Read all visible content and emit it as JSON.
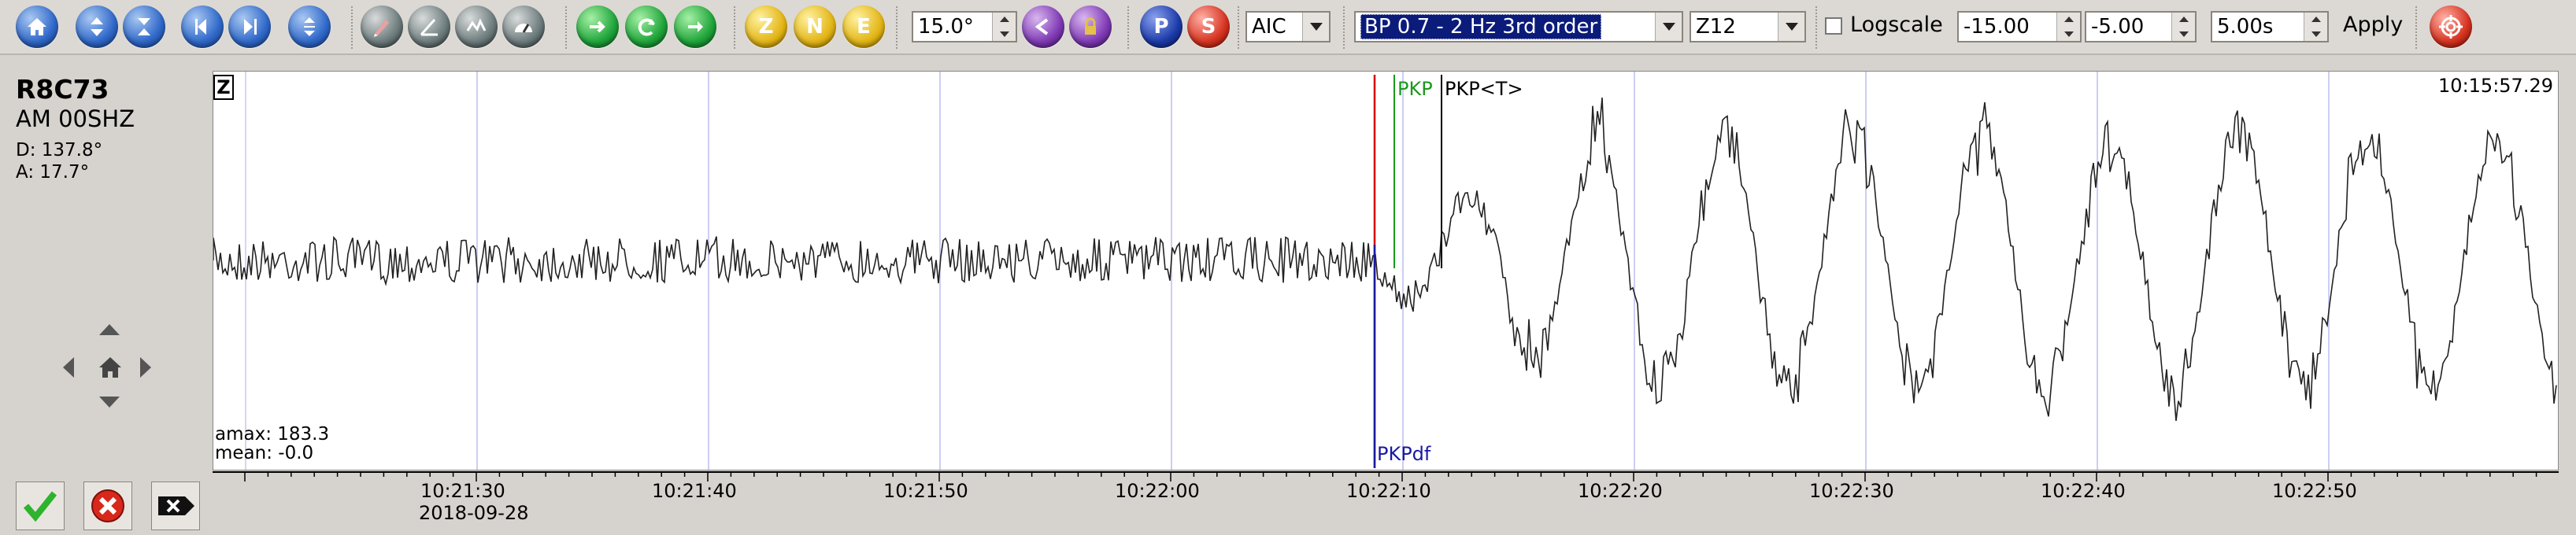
{
  "toolbar": {
    "buttons": [
      {
        "icon": "home-icon",
        "color": "blue"
      },
      {
        "icon": "zoom-in-vertical-icon",
        "color": "blue"
      },
      {
        "icon": "zoom-out-vertical-icon",
        "color": "blue"
      },
      {
        "icon": "step-back-icon",
        "color": "blue"
      },
      {
        "icon": "skip-forward-icon",
        "color": "blue"
      },
      {
        "icon": "expand-vertical-icon",
        "color": "blue"
      },
      {
        "icon": "pick-tool-icon",
        "color": "gray"
      },
      {
        "icon": "measure-angle-icon",
        "color": "gray"
      },
      {
        "icon": "spectrogram-icon",
        "color": "gray"
      },
      {
        "icon": "gauge-icon",
        "color": "gray"
      },
      {
        "icon": "align-icon",
        "color": "green"
      },
      {
        "icon": "swap-icon",
        "color": "green"
      },
      {
        "icon": "refresh-icon",
        "color": "green"
      }
    ],
    "components": {
      "z": "Z",
      "n": "N",
      "e": "E"
    },
    "angle_value": "15.0°",
    "phase_p": "P",
    "phase_s": "S",
    "picker_method": "AIC",
    "filter_value": "BP 0.7 - 2 Hz  3rd order",
    "channel_value": "Z12",
    "logscale_label": "Logscale",
    "logscale_checked": false,
    "min_value": "-15.00",
    "max_value": "-5.00",
    "duration_value": "5.00s",
    "apply_label": "Apply"
  },
  "station": {
    "code": "R8C73",
    "network_channel": "AM  00SHZ",
    "distance": "D:  137.8°",
    "azimuth": "A:  17.7°"
  },
  "trace": {
    "component_tag": "Z",
    "clock": "10:15:57.29",
    "amax": "amax: 183.3",
    "mean": "mean: -0.0",
    "picks": [
      {
        "label": "PKP",
        "color": "#1b9a1b"
      },
      {
        "label": "PKP<T>",
        "color": "#000000"
      },
      {
        "label": "PKPdf",
        "color": "#1a1aa0"
      }
    ],
    "red_marker_color": "#d90000"
  },
  "time_axis": {
    "ticks": [
      "10:21:30",
      "10:21:40",
      "10:21:50",
      "10:22:00",
      "10:22:10",
      "10:22:20",
      "10:22:30",
      "10:22:40",
      "10:22:50"
    ],
    "date": "2018-09-28"
  }
}
